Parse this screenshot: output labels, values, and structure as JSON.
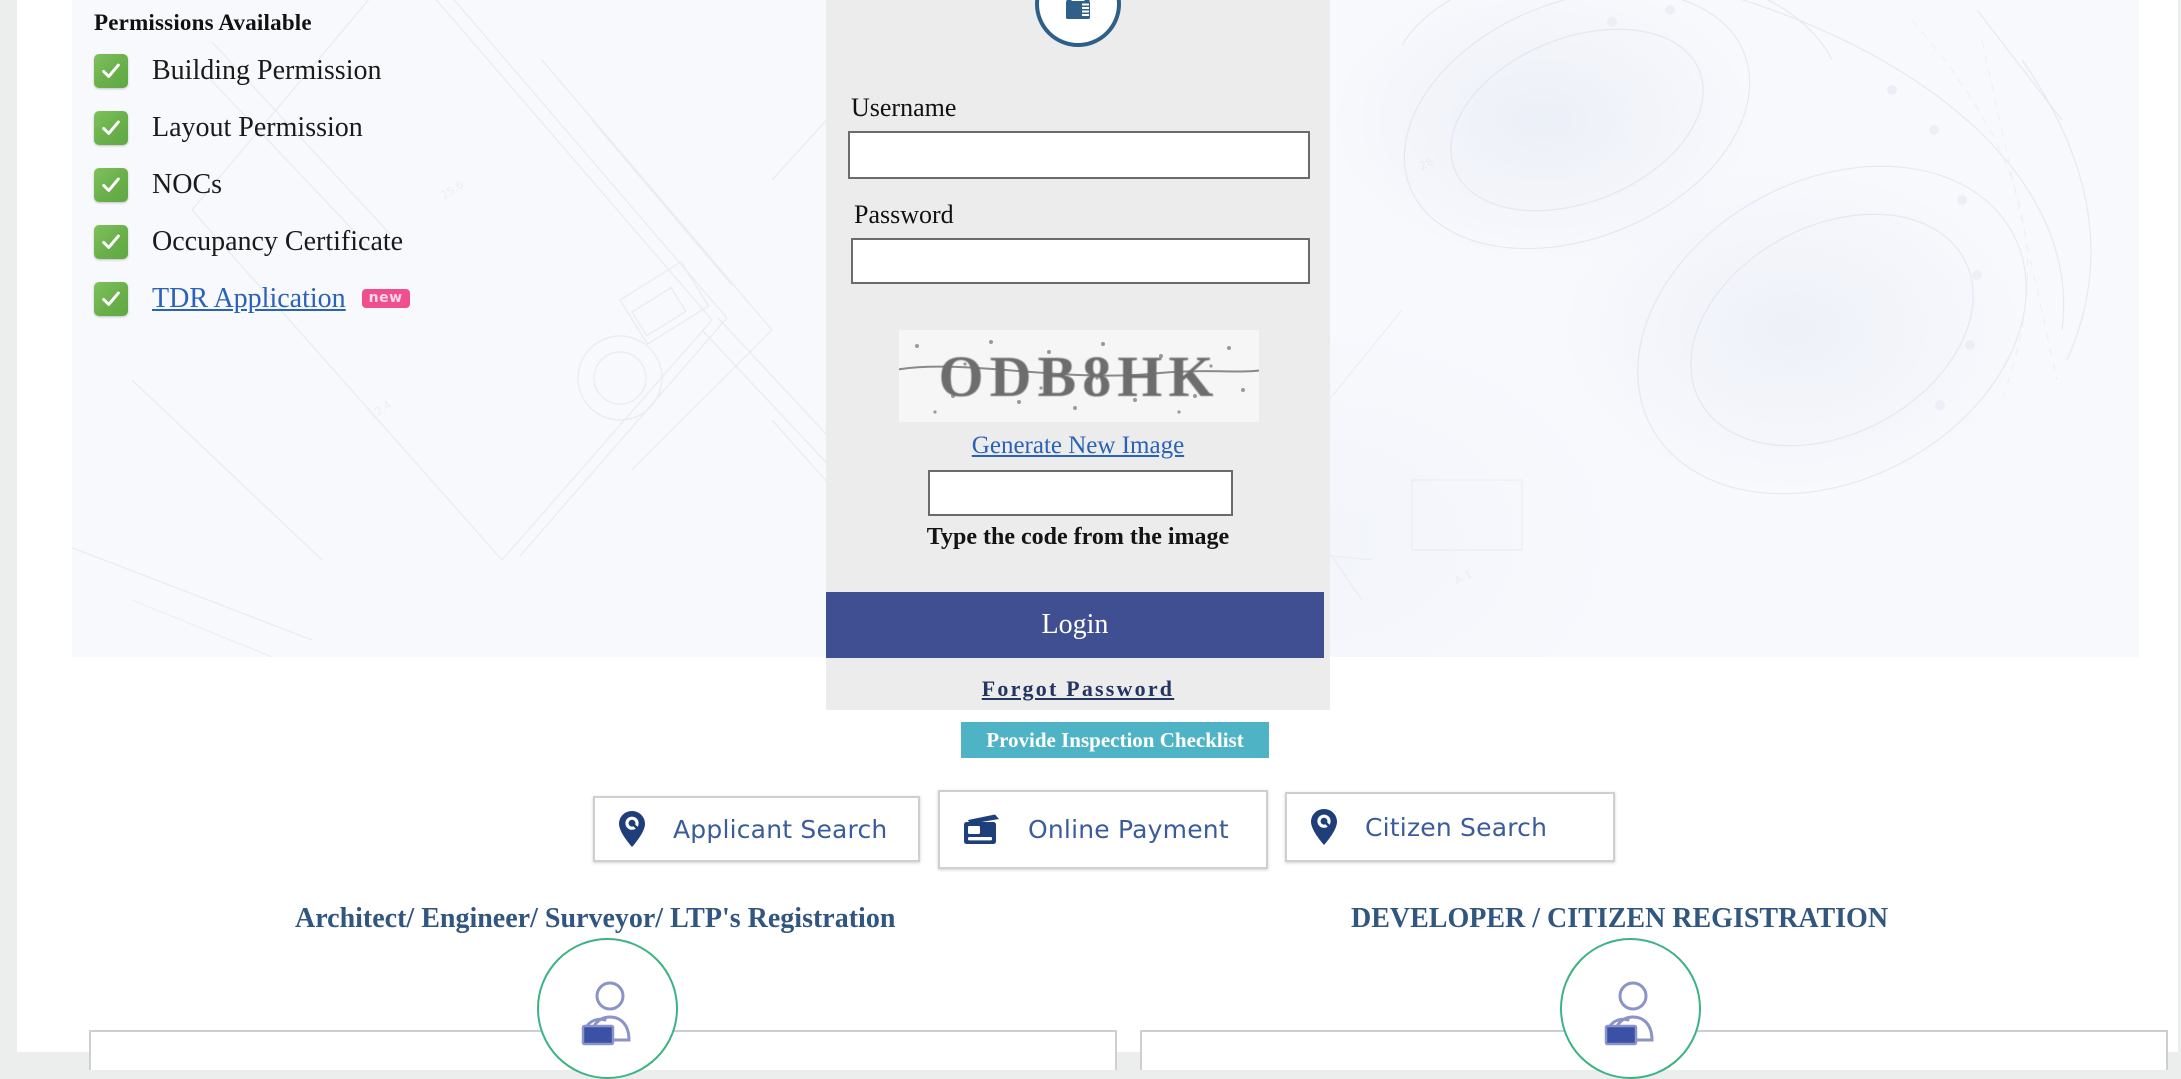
{
  "permissions": {
    "title": "Permissions Available",
    "items": [
      {
        "label": "Building Permission",
        "is_link": false,
        "badge": null
      },
      {
        "label": "Layout Permission",
        "is_link": false,
        "badge": null
      },
      {
        "label": "NOCs",
        "is_link": false,
        "badge": null
      },
      {
        "label": "Occupancy Certificate",
        "is_link": false,
        "badge": null
      },
      {
        "label": "TDR Application",
        "is_link": true,
        "badge": "new"
      }
    ]
  },
  "login": {
    "lock_icon": "padlock-icon",
    "username_label": "Username",
    "username_value": "",
    "username_placeholder": "",
    "password_label": "Password",
    "password_value": "",
    "password_placeholder": "",
    "captcha_text": "ODB8HK",
    "generate_link": "Generate New Image",
    "captcha_value": "",
    "captcha_placeholder": "",
    "captcha_hint": "Type the code from the image",
    "login_button": "Login",
    "forgot_password": "Forgot Password"
  },
  "checklist_button": "Provide Inspection Checklist",
  "search_buttons": [
    {
      "label": "Applicant Search",
      "icon": "location-pin-icon"
    },
    {
      "label": "Online Payment",
      "icon": "payment-card-icon"
    },
    {
      "label": "Citizen Search",
      "icon": "location-pin-icon"
    }
  ],
  "registration": {
    "architect_heading": "Architect/ Engineer/ Surveyor/ LTP's Registration",
    "developer_heading": "DEVELOPER / CITIZEN REGISTRATION",
    "avatar_icon": "user-at-desk-icon"
  },
  "colors": {
    "login_button": "#3f4f91",
    "checklist_button": "#4fb3c6",
    "panel_bg": "#ececec",
    "link": "#2a62b8",
    "heading": "#31567f",
    "check_green": "#6ab04a",
    "badge_pink": "#ef4f8f",
    "avatar_ring": "#3bb383",
    "lock_blue": "#2e5f88"
  }
}
